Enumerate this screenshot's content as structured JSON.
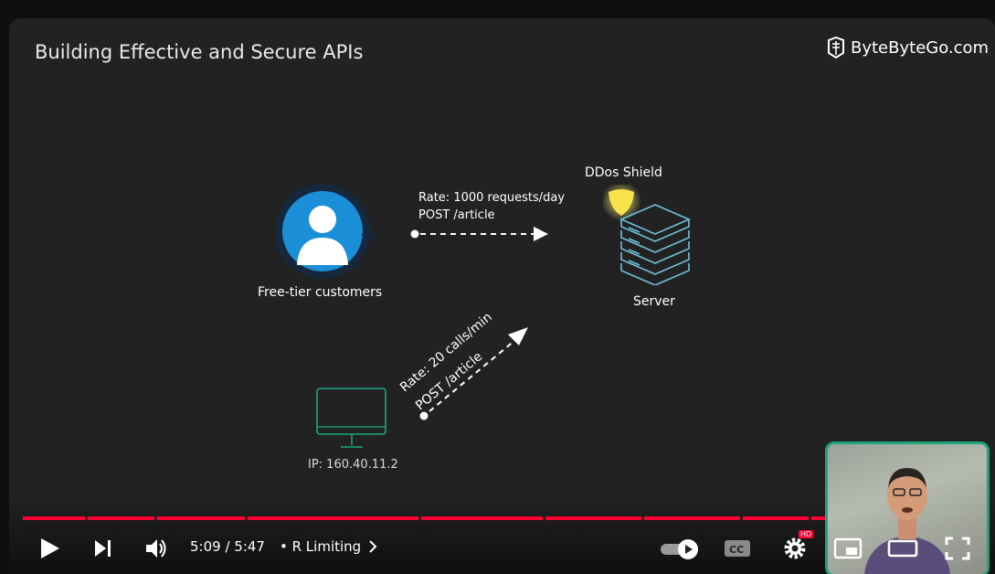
{
  "slide": {
    "title": "Building Effective and Secure APIs",
    "brand": "ByteByteGo.com",
    "customer_label": "Free-tier customers",
    "shield_label": "DDos Shield",
    "server_label": "Server",
    "rate_top_line1": "Rate: 1000 requests/day",
    "rate_top_line2": "POST /article",
    "rate_diag_line1": "Rate: 20 calls/min",
    "rate_diag_line2": "POST /article",
    "ip_label": "IP: 160.40.11.2"
  },
  "player": {
    "time": "5:09 / 5:47",
    "chapter": "• R Limiting",
    "progress_fraction": 0.89,
    "hd_badge": "HD",
    "accent_color": "#ff0033"
  }
}
